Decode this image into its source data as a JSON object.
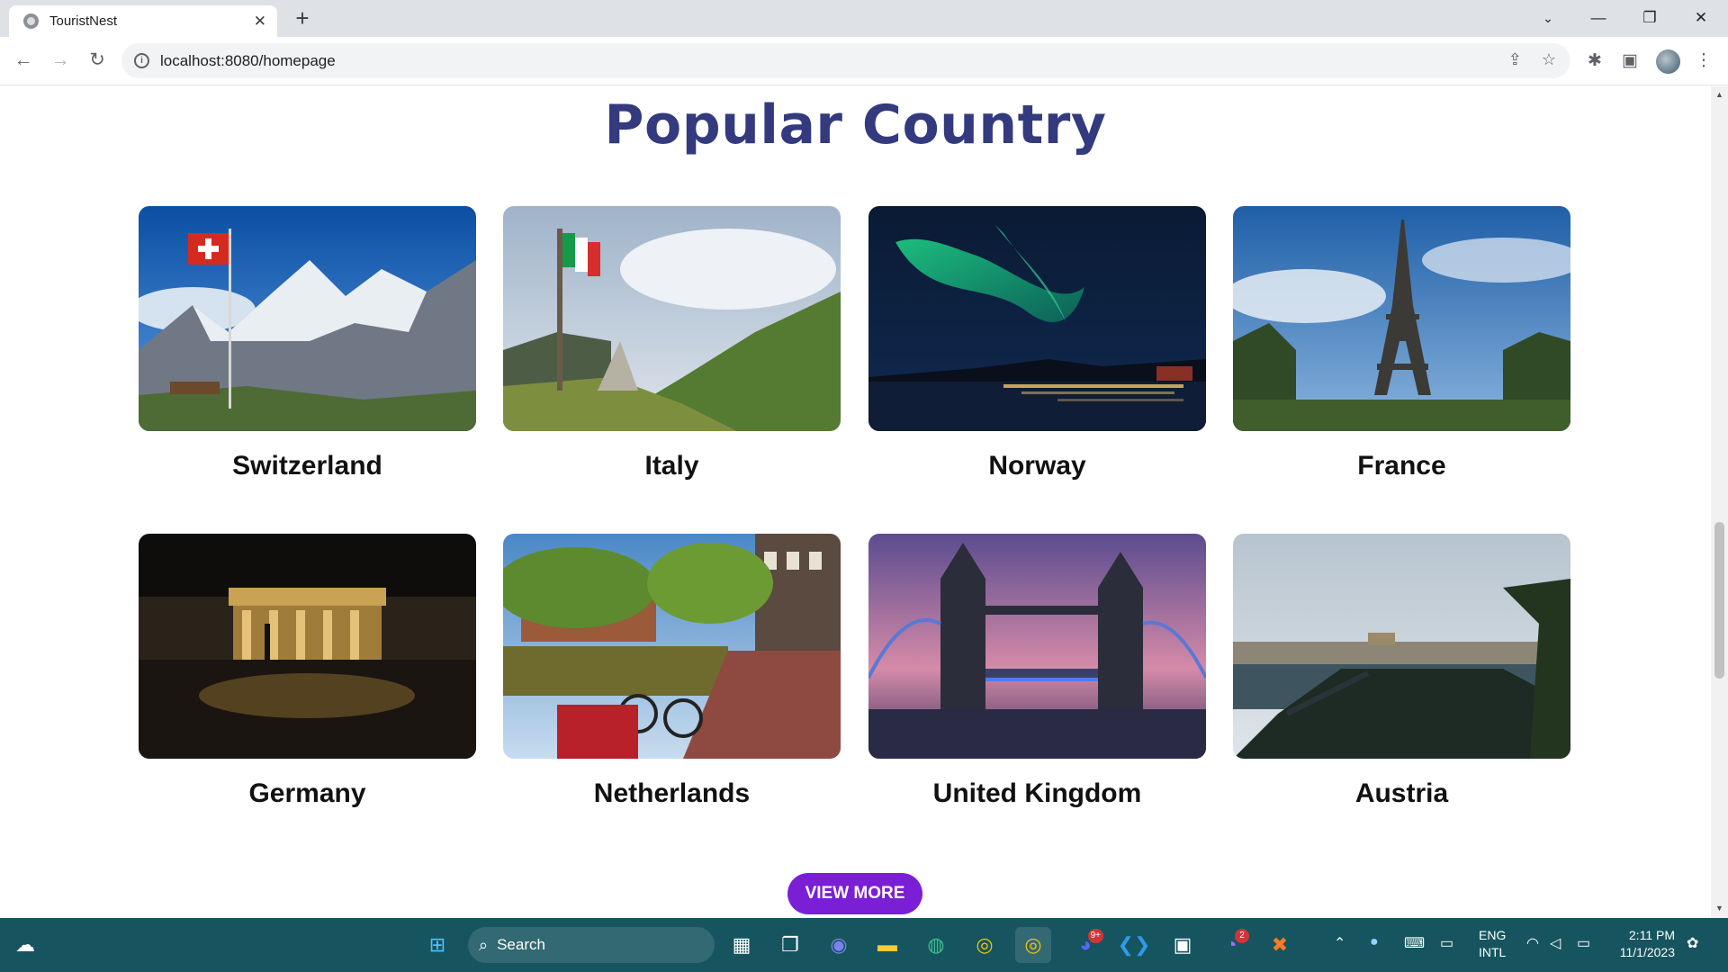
{
  "browser": {
    "tab_title": "TouristNest",
    "url": "localhost:8080/homepage"
  },
  "page": {
    "heading": "Popular Country",
    "countries": [
      {
        "name": "Switzerland"
      },
      {
        "name": "Italy"
      },
      {
        "name": "Norway"
      },
      {
        "name": "France"
      },
      {
        "name": "Germany"
      },
      {
        "name": "Netherlands"
      },
      {
        "name": "United Kingdom"
      },
      {
        "name": "Austria"
      }
    ],
    "view_more_label": "VIEW MORE"
  },
  "taskbar": {
    "search_label": "Search",
    "language": "ENG",
    "keyboard": "INTL",
    "time": "2:11 PM",
    "date": "11/1/2023",
    "discord_badge": "9+",
    "messenger_badge": "2"
  },
  "colors": {
    "heading": "#343a7e",
    "button": "#7a1fd6",
    "taskbar": "#16555f"
  }
}
